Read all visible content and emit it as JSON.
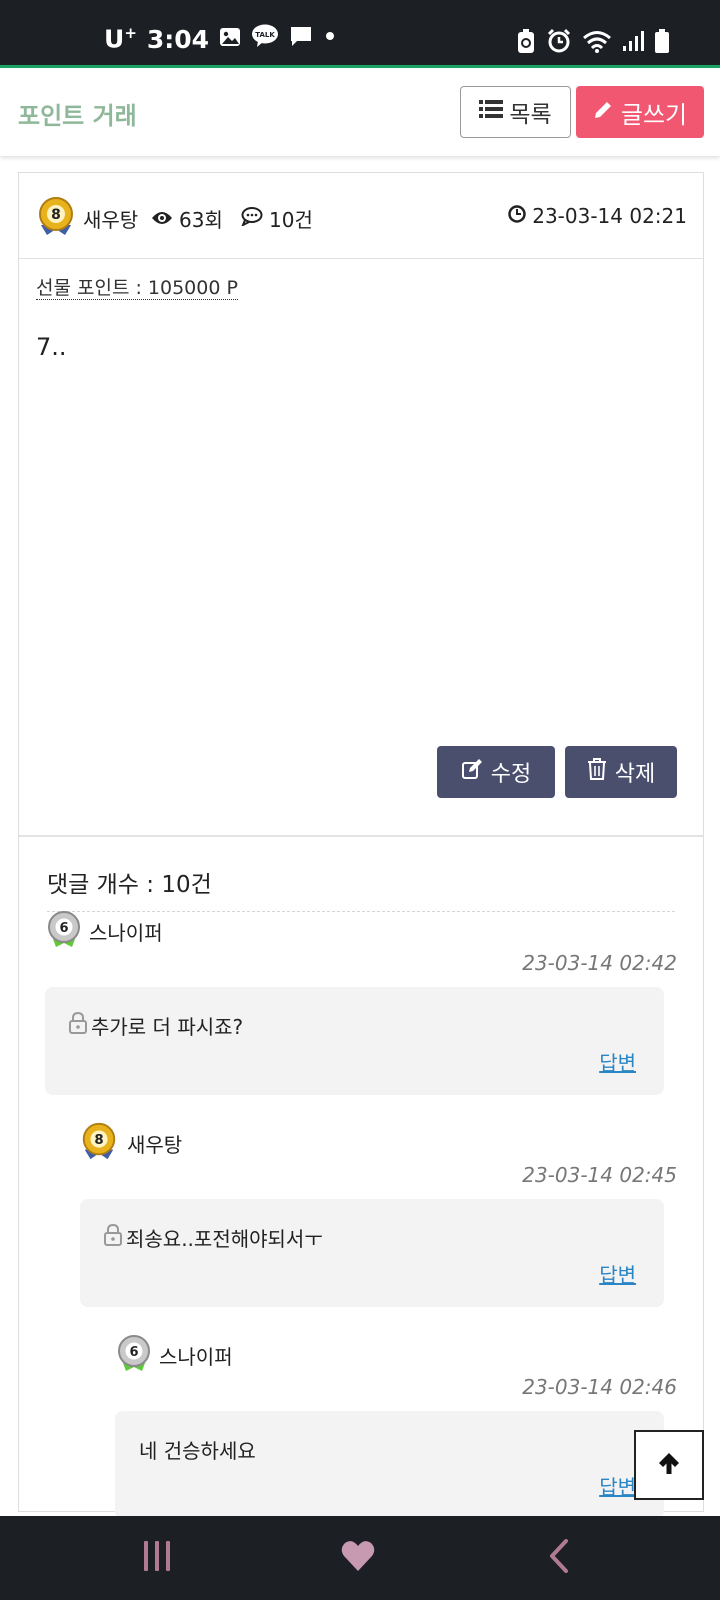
{
  "status_bar": {
    "carrier": "U",
    "carrier_sup": "+",
    "time": "3:04",
    "icons": [
      "gallery-icon",
      "kakaotalk-icon",
      "message-icon",
      "dot-icon",
      "recycle-battery-icon",
      "alarm-icon",
      "wifi-icon",
      "signal-icon",
      "battery-icon"
    ],
    "talk_label": "TALK"
  },
  "header": {
    "title": "포인트 거래",
    "list_button": "목록",
    "write_button": "글쓰기"
  },
  "post": {
    "author_level": "8",
    "author": "새우탕",
    "views": "63회",
    "comments": "10건",
    "date": "23-03-14 02:21",
    "gift_points": "선물 포인트 : 105000 P",
    "body": "7..",
    "edit_button": "수정",
    "delete_button": "삭제"
  },
  "comments_section": {
    "count_label": "댓글 개수 : 10건",
    "items": [
      {
        "level": "6",
        "user": "스나이퍼",
        "date": "23-03-14 02:42",
        "text": "추가로 더 파시죠?",
        "secret": true,
        "reply": "답변"
      },
      {
        "level": "8",
        "user": "새우탕",
        "date": "23-03-14 02:45",
        "text": "죄송요..포전해야되서ㅜ",
        "secret": true,
        "reply": "답변"
      },
      {
        "level": "6",
        "user": "스나이퍼",
        "date": "23-03-14 02:46",
        "text": "네 건승하세요",
        "secret": false,
        "reply": "답변"
      }
    ]
  },
  "colors": {
    "brand_title": "#8fb89a",
    "write_button": "#f25771",
    "action_button": "#4b4f6e",
    "reply_link": "#2a85c5",
    "system_bar": "#1c1f24",
    "accent_line": "#19a463"
  },
  "nav_bar": {
    "icons": [
      "recent-apps-icon",
      "home-heart-icon",
      "back-icon"
    ]
  }
}
